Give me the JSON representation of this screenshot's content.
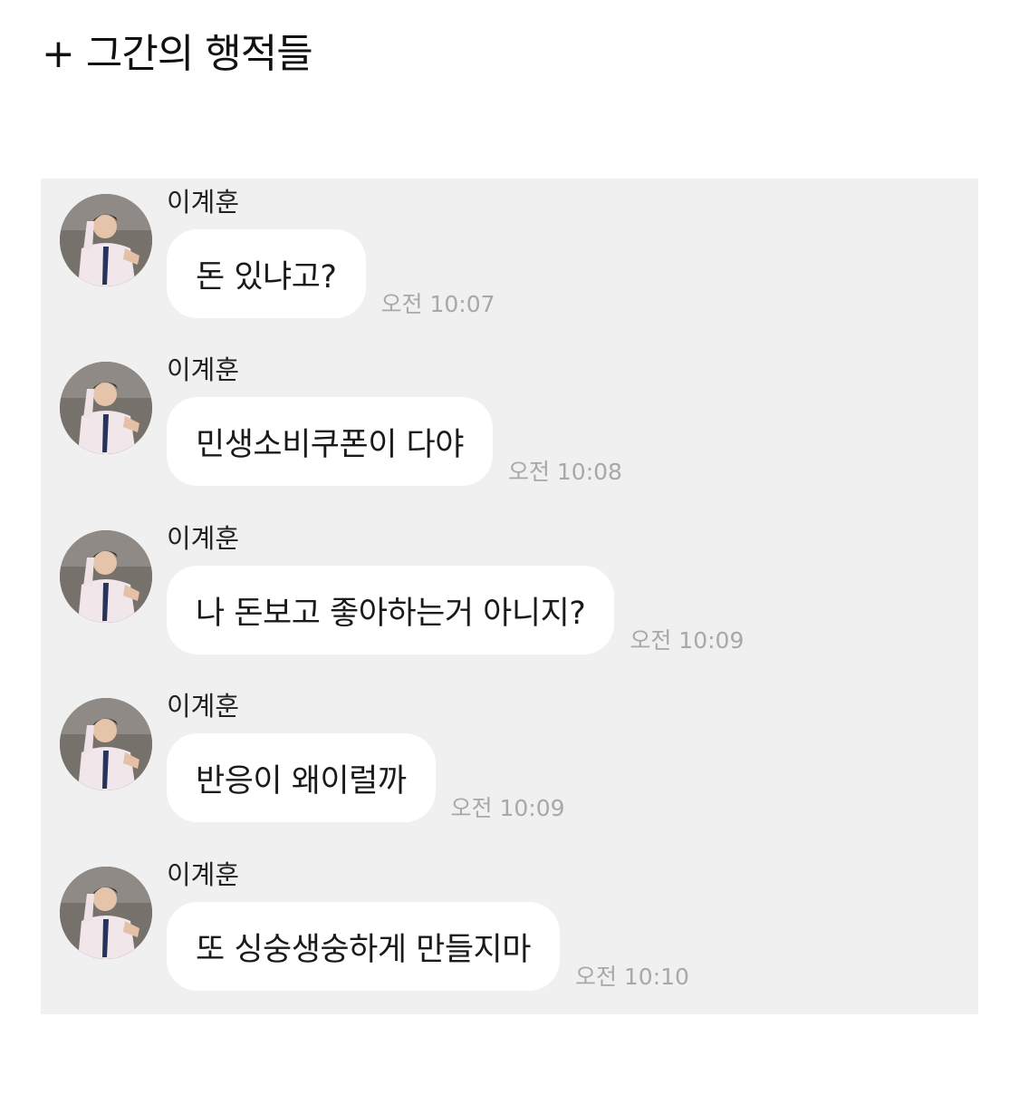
{
  "heading": "+ 그간의 행적들",
  "messages": [
    {
      "sender": "이계훈",
      "text": "돈 있냐고?",
      "time": "오전 10:07"
    },
    {
      "sender": "이계훈",
      "text": "민생소비쿠폰이 다야",
      "time": "오전 10:08"
    },
    {
      "sender": "이계훈",
      "text": "나 돈보고 좋아하는거 아니지?",
      "time": "오전 10:09"
    },
    {
      "sender": "이계훈",
      "text": "반응이 왜이럴까",
      "time": "오전 10:09"
    },
    {
      "sender": "이계훈",
      "text": "또 싱숭생숭하게 만들지마",
      "time": "오전 10:10"
    }
  ],
  "colors": {
    "panel_background": "#f0f0f0",
    "bubble_background": "#ffffff",
    "timestamp": "#a8a8a8"
  },
  "icons": {
    "avatar": "profile-photo-avatar"
  }
}
